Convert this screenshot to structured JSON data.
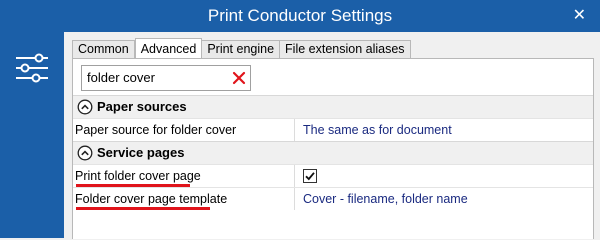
{
  "window": {
    "title": "Print Conductor Settings"
  },
  "tabs": [
    {
      "label": "Common"
    },
    {
      "label": "Advanced"
    },
    {
      "label": "Print engine"
    },
    {
      "label": "File extension aliases"
    }
  ],
  "search": {
    "value": "folder cover"
  },
  "categories": [
    {
      "label": "Paper sources",
      "rows": [
        {
          "name": "Paper source for folder cover",
          "value": "The same as for document"
        }
      ]
    },
    {
      "label": "Service pages",
      "rows": [
        {
          "name": "Print folder cover page",
          "checked": true
        },
        {
          "name": "Folder cover page template",
          "value": "Cover - filename, folder name"
        }
      ]
    }
  ],
  "colors": {
    "accent": "#1b5fa8",
    "value_text": "#1a2a80",
    "highlight": "#e0141b"
  },
  "icons": {
    "sidebar": "settings-sliders-icon",
    "close": "close-icon",
    "clear": "clear-search-icon",
    "collapse": "chevron-up-circle-icon"
  }
}
